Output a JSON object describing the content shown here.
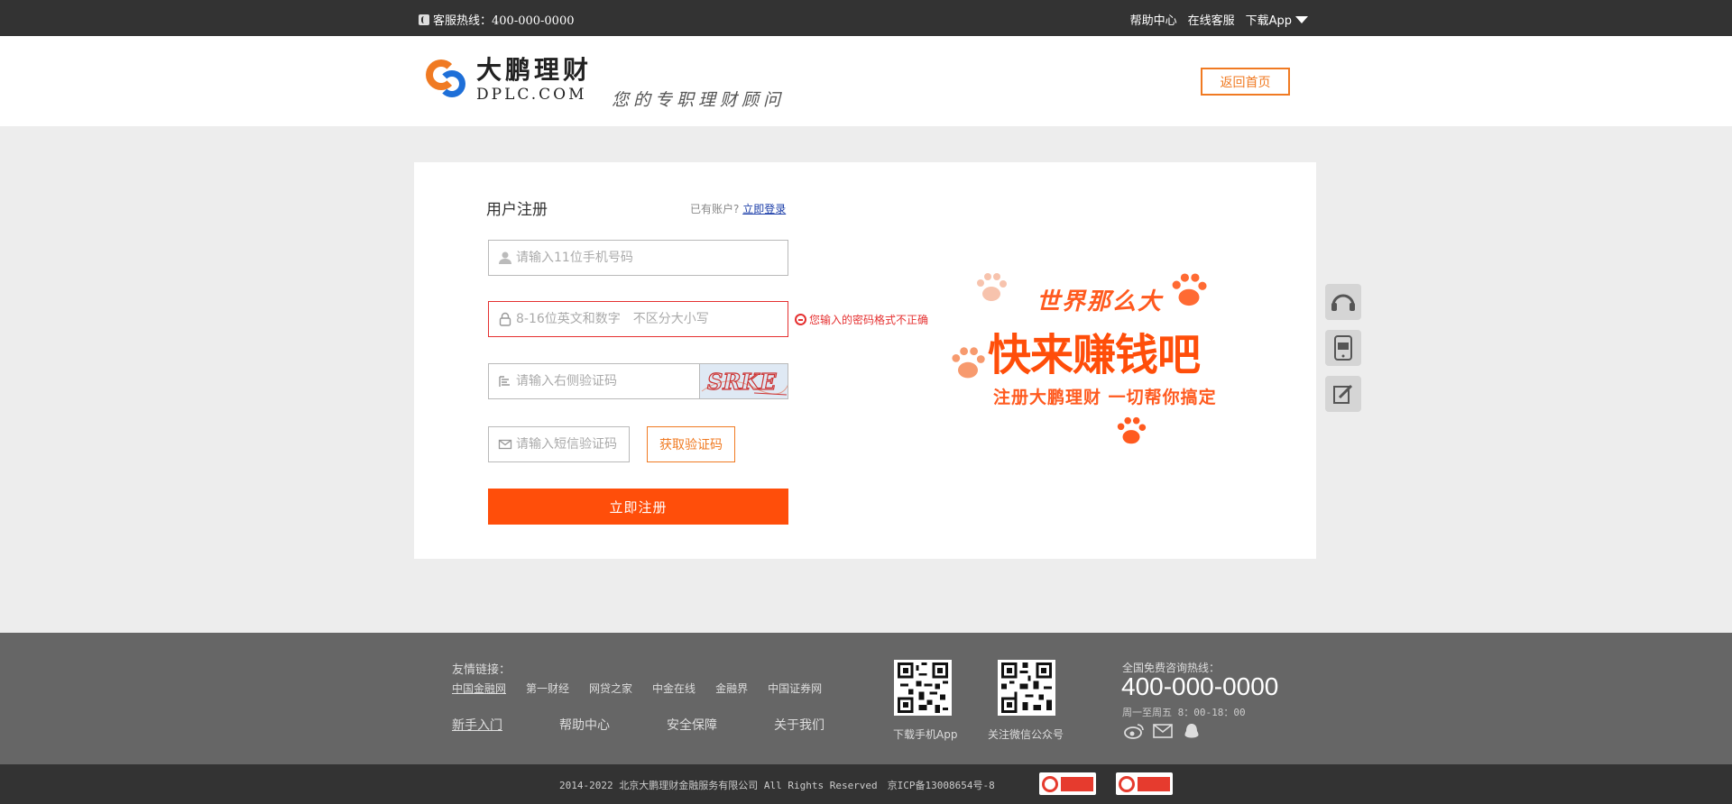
{
  "topbar": {
    "hotline": "客服热线：400-000-0000",
    "nav": [
      "帮助中心",
      "在线客服",
      "下载App"
    ]
  },
  "header": {
    "logo_cn": "大鹏理财",
    "logo_en": "DPLC.COM",
    "slogan": "您的专职理财顾问",
    "home_button": "返回首页"
  },
  "form": {
    "title": "用户注册",
    "have_account": "已有账户?",
    "login_link": "立即登录",
    "phone_placeholder": "请输入11位手机号码",
    "password_placeholder": "8-16位英文和数字　不区分大小写",
    "password_error": "您输入的密码格式不正确",
    "captcha_placeholder": "请输入右侧验证码",
    "captcha_text": "SRKE",
    "sms_placeholder": "请输入短信验证码",
    "sms_button": "获取验证码",
    "submit": "立即注册"
  },
  "promo": {
    "line1": "世界那么大",
    "line2": "快来赚钱吧",
    "line3": "注册大鹏理财 一切帮你搞定"
  },
  "side_tools": [
    "headset-icon",
    "app-icon",
    "edit-icon"
  ],
  "footer": {
    "links_label": "友情链接：",
    "links": [
      "中国金融网",
      "第一财经",
      "网贷之家",
      "中金在线",
      "金融界",
      "中国证券网"
    ],
    "nav": [
      "新手入门",
      "帮助中心",
      "安全保障",
      "关于我们"
    ],
    "qr_app_caption": "下载手机App",
    "qr_wechat_caption": "关注微信公众号",
    "hotline_label": "全国免费咨询热线：",
    "hotline_number": "400-000-0000",
    "hotline_hours": "周一至周五 8：00-18：00",
    "copyright": "2014-2022 北京大鹏理财金融服务有限公司 All Rights Reserved　京ICP备13008654号-8"
  },
  "colors": {
    "accent": "#ff4e0a",
    "orange_border": "#f07a22",
    "error": "#e53030",
    "topbar": "#333333",
    "footer": "#666666"
  }
}
